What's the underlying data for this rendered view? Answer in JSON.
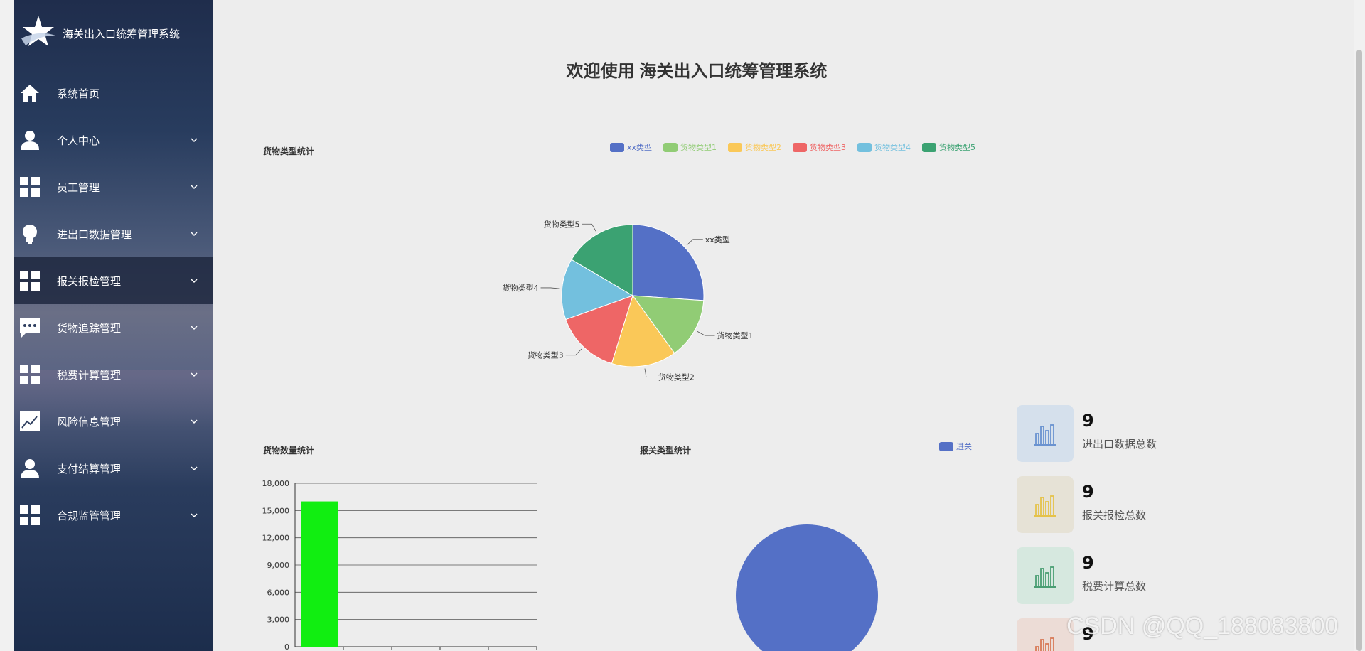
{
  "sidebar": {
    "title": "海关出入口统筹管理系统",
    "items": [
      {
        "label": "系统首页",
        "icon": "home-icon",
        "has_children": false,
        "active": false
      },
      {
        "label": "个人中心",
        "icon": "user-icon",
        "has_children": true,
        "active": false
      },
      {
        "label": "员工管理",
        "icon": "grid-icon",
        "has_children": true,
        "active": false
      },
      {
        "label": "进出口数据管理",
        "icon": "bulb-icon",
        "has_children": true,
        "active": false
      },
      {
        "label": "报关报检管理",
        "icon": "grid-icon",
        "has_children": true,
        "active": true
      },
      {
        "label": "货物追踪管理",
        "icon": "chat-icon",
        "has_children": true,
        "active": false
      },
      {
        "label": "税费计算管理",
        "icon": "grid-icon",
        "has_children": true,
        "active": false
      },
      {
        "label": "风险信息管理",
        "icon": "trend-icon",
        "has_children": true,
        "active": false
      },
      {
        "label": "支付结算管理",
        "icon": "user-icon",
        "has_children": true,
        "active": false
      },
      {
        "label": "合规监管管理",
        "icon": "grid-icon",
        "has_children": true,
        "active": false
      }
    ]
  },
  "main": {
    "welcome": "欢迎使用 海关出入口统筹管理系统"
  },
  "colors": {
    "series": [
      "#5470c6",
      "#91cc75",
      "#fac858",
      "#ee6666",
      "#73c0de",
      "#3ba272"
    ],
    "bar": "#11ee11"
  },
  "chart_data": [
    {
      "type": "pie",
      "title": "货物类型统计",
      "legend_position": "top-center",
      "categories": [
        "xx类型",
        "货物类型1",
        "货物类型2",
        "货物类型3",
        "货物类型4",
        "货物类型5"
      ],
      "values": [
        3,
        1.6,
        1.7,
        1.7,
        1.6,
        1.9
      ]
    },
    {
      "type": "bar",
      "title": "货物数量统计",
      "categories": [
        "",
        "",
        "",
        "",
        ""
      ],
      "values": [
        16000,
        0,
        0,
        0,
        0
      ],
      "ylim": [
        0,
        18000
      ],
      "yticks": [
        "0",
        "3,000",
        "6,000",
        "9,000",
        "12,000",
        "15,000",
        "18,000"
      ],
      "grid": true
    },
    {
      "type": "pie",
      "title": "报关类型统计",
      "legend_position": "top-right",
      "categories": [
        "进关"
      ],
      "values": [
        1
      ]
    }
  ],
  "stats": [
    {
      "value": "9",
      "label": "进出口数据总数",
      "bg": "#d5e0ec",
      "color": "#6a93d0"
    },
    {
      "value": "9",
      "label": "报关报检总数",
      "bg": "#e6e2d6",
      "color": "#e5c24a"
    },
    {
      "value": "9",
      "label": "税费计算总数",
      "bg": "#d6e8df",
      "color": "#4a9e73"
    },
    {
      "value": "9",
      "label": "",
      "bg": "#ecdcd6",
      "color": "#d87a58"
    }
  ],
  "watermark": "CSDN @QQ_188083800"
}
